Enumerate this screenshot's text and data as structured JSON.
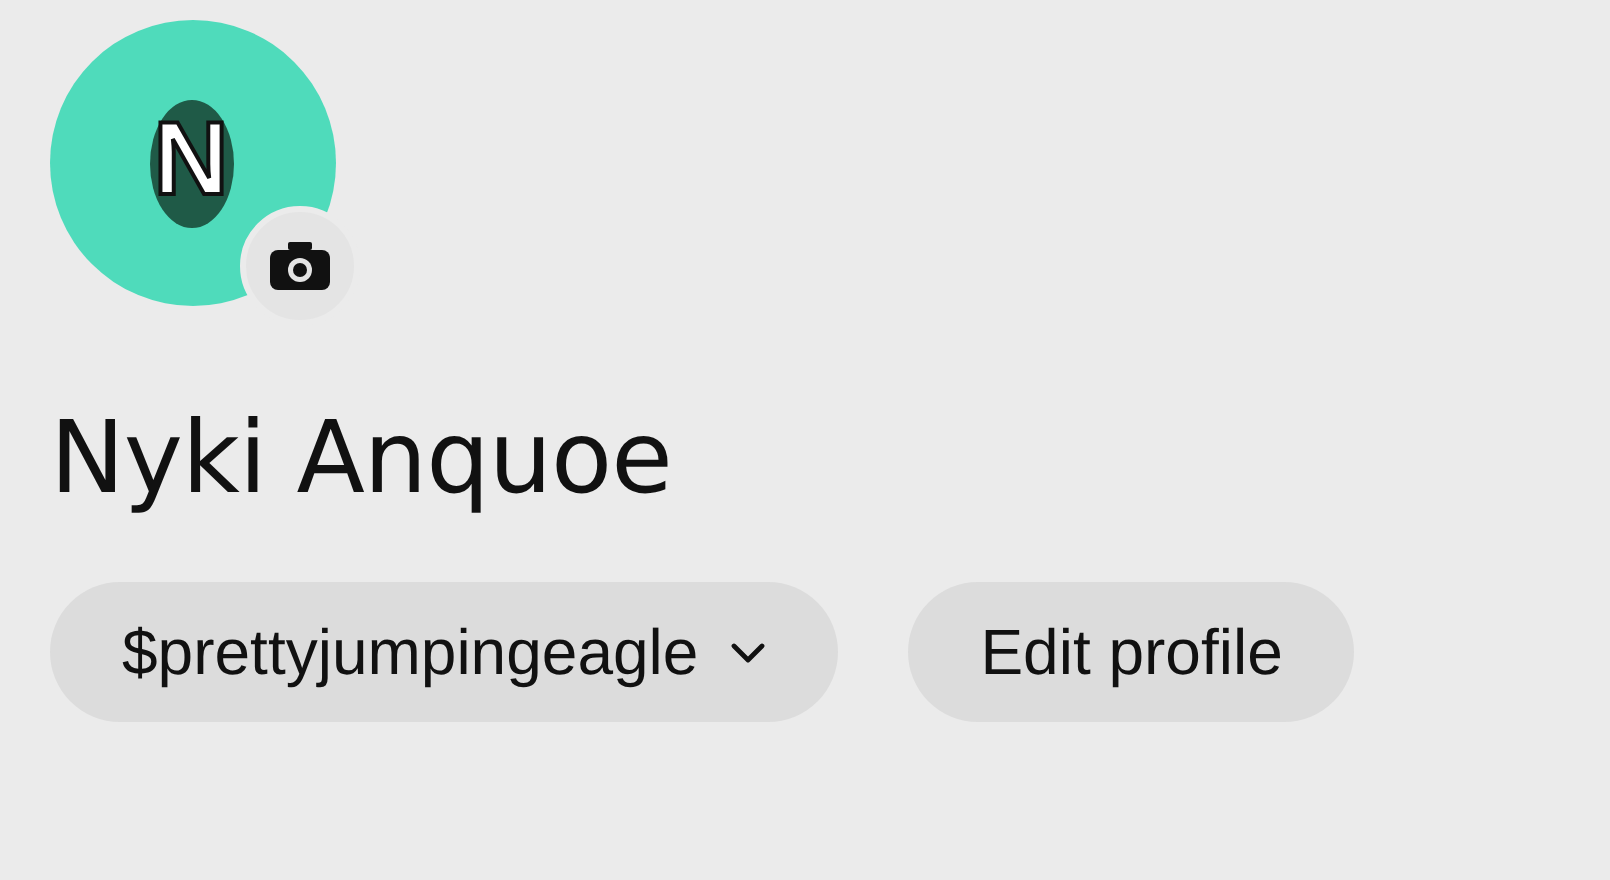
{
  "avatar": {
    "initial": "N"
  },
  "name": "Nyki Anquoe",
  "buttons": [
    {
      "label": "$prettyjumpingeagle",
      "kind": "dropdown"
    },
    {
      "label": "Edit profile",
      "kind": "plain"
    }
  ]
}
